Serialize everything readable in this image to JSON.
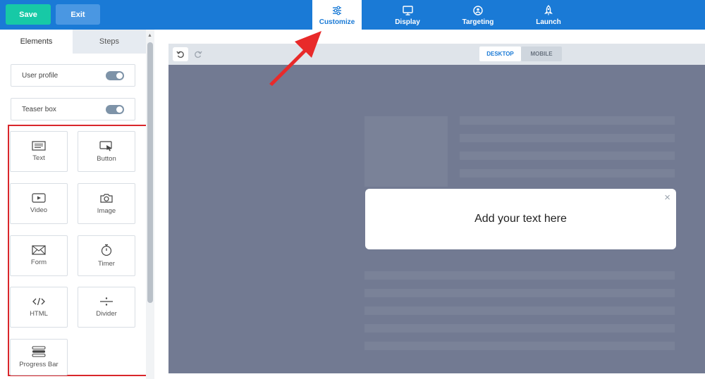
{
  "topbar": {
    "save_label": "Save",
    "exit_label": "Exit",
    "tabs": [
      {
        "label": "Customize",
        "icon": "sliders-icon",
        "active": true
      },
      {
        "label": "Display",
        "icon": "monitor-icon",
        "active": false
      },
      {
        "label": "Targeting",
        "icon": "target-user-icon",
        "active": false
      },
      {
        "label": "Launch",
        "icon": "rocket-icon",
        "active": false
      }
    ]
  },
  "sidebar": {
    "tabs": [
      "Elements",
      "Steps"
    ],
    "toggles": [
      {
        "label": "User profile",
        "on": false
      },
      {
        "label": "Teaser box",
        "on": false
      }
    ],
    "elements": [
      {
        "label": "Text",
        "icon": "text-icon"
      },
      {
        "label": "Button",
        "icon": "button-cursor-icon"
      },
      {
        "label": "Video",
        "icon": "video-icon"
      },
      {
        "label": "Image",
        "icon": "camera-icon"
      },
      {
        "label": "Form",
        "icon": "envelope-icon"
      },
      {
        "label": "Timer",
        "icon": "stopwatch-icon"
      },
      {
        "label": "HTML",
        "icon": "code-icon"
      },
      {
        "label": "Divider",
        "icon": "divide-icon"
      },
      {
        "label": "Progress Bar",
        "icon": "progress-bar-icon"
      }
    ]
  },
  "canvas": {
    "devices": [
      "DESKTOP",
      "MOBILE"
    ],
    "active_device": "DESKTOP",
    "popup_text": "Add your text here",
    "popup_close": "×"
  },
  "colors": {
    "primary": "#1a7ad6",
    "save": "#17c9a6",
    "canvas_overlay": "#727a92",
    "highlight": "#d9262b"
  }
}
